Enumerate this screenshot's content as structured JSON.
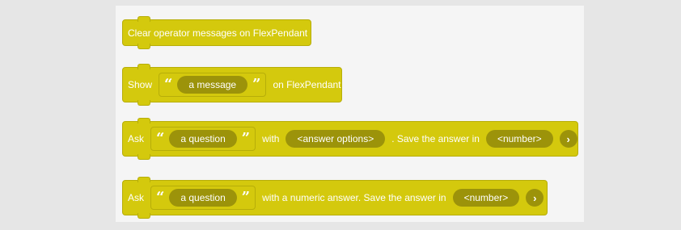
{
  "blocks": {
    "clear": {
      "label": "Clear operator messages on FlexPendant"
    },
    "show": {
      "label": "Show",
      "quote_open": "“",
      "message": "a message",
      "quote_close": "”",
      "suffix": "on FlexPendant"
    },
    "ask_options": {
      "label": "Ask",
      "quote_open": "“",
      "question": "a question",
      "quote_close": "”",
      "with": "with",
      "options": "<answer options>",
      "save": ". Save the answer in",
      "var": "<number>",
      "arrow": "›"
    },
    "ask_numeric": {
      "label": "Ask",
      "quote_open": "“",
      "question": "a question",
      "quote_close": "”",
      "mid": "with a numeric answer. Save the answer in",
      "var": "<number>",
      "arrow": "›"
    }
  },
  "colors": {
    "block": "#d4c90d",
    "pill": "#9c930a",
    "workspace": "#f5f5f5"
  }
}
